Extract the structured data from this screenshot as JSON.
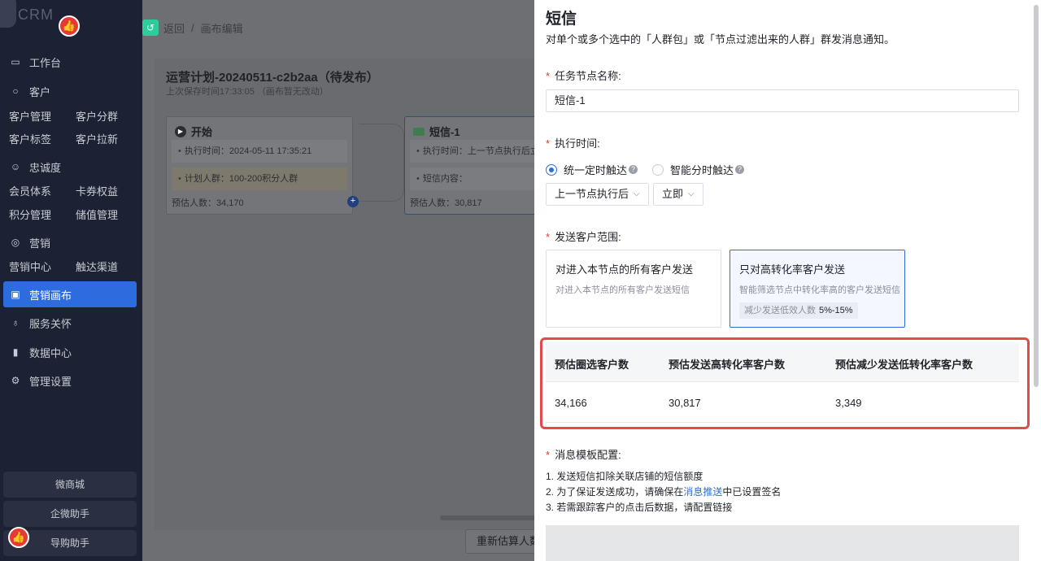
{
  "sidebar": {
    "logo_text": "CRM",
    "badge_icon": "thumbs-up-icon",
    "items": [
      {
        "label": "工作台",
        "icon": "monitor-icon"
      },
      {
        "label": "客户",
        "icon": "user-icon"
      },
      {
        "label": "忠诚度",
        "icon": "smile-icon"
      },
      {
        "label": "营销",
        "icon": "target-icon"
      },
      {
        "label": "营销画布",
        "icon": "clipboard-icon"
      },
      {
        "label": "服务关怀",
        "icon": "medal-icon"
      },
      {
        "label": "数据中心",
        "icon": "bar-chart-icon"
      },
      {
        "label": "管理设置",
        "icon": "gear-icon"
      }
    ],
    "sub": {
      "customer_mgmt": "客户管理",
      "customer_group": "客户分群",
      "customer_tag": "客户标签",
      "customer_pull": "客户拉新",
      "member_system": "会员体系",
      "card_coupon": "卡券权益",
      "points_mgmt": "积分管理",
      "stored_value": "储值管理",
      "marketing_center": "营销中心",
      "reach_channel": "触达渠道"
    },
    "bottom_buttons": [
      "微商城",
      "企微助手",
      "导购助手"
    ],
    "active_color": "#2d6cdf"
  },
  "breadcrumb": {
    "back": "返回",
    "separator": "/",
    "current": "画布编辑"
  },
  "plan": {
    "title": "运营计划-20240511-c2b2aa（待发布）",
    "subtitle": "上次保存时间17:33:05 （画布暂无改动）"
  },
  "nodes": {
    "start": {
      "title": "开始",
      "exec_time": "执行时间：2024-05-11 17:35:21",
      "plan_people": "计划人群：100-200积分人群",
      "estimate": "预估人数：34,170"
    },
    "sms": {
      "title": "短信-1",
      "exec_time": "执行时间：上一节点执行后立即",
      "content": "短信内容：",
      "estimate": "预估人数：30,817"
    }
  },
  "reestimate_button": "重新估算人数",
  "drawer": {
    "title": "短信",
    "description": "对单个或多个选中的「人群包」或「节点过滤出来的人群」群发消息通知。",
    "required_mark": "*",
    "task_name_label": "任务节点名称:",
    "task_name_value": "短信-1",
    "exec_time_label": "执行时间:",
    "radio_fixed": "统一定时触达",
    "radio_smart": "智能分时触达",
    "help_mark": "?",
    "select_after": "上一节点执行后",
    "select_immediate": "立即",
    "scope_label": "发送客户范围:",
    "option_all": {
      "title": "对进入本节点的所有客户发送",
      "desc": "对进入本节点的所有客户发送短信"
    },
    "option_high": {
      "title": "只对高转化率客户发送",
      "desc": "智能筛选节点中转化率高的客户发送短信",
      "tag_label": "减少发送低效人数",
      "tag_value": "5%-15%"
    },
    "estimate_table": {
      "headers": [
        "预估圈选客户数",
        "预估发送高转化率客户数",
        "预估减少发送低转化率客户数"
      ],
      "values": [
        "34,166",
        "30,817",
        "3,349"
      ]
    },
    "template_label": "消息模板配置:",
    "notes": {
      "n1": "1. 发送短信扣除关联店铺的短信额度",
      "n2_pre": "2. 为了保证发送成功，请确保在",
      "n2_link": "消息推送",
      "n2_post": "中已设置签名",
      "n3": "3. 若需跟踪客户的点击后数据，请配置链接"
    },
    "highlight_color": "#e34a4a"
  }
}
